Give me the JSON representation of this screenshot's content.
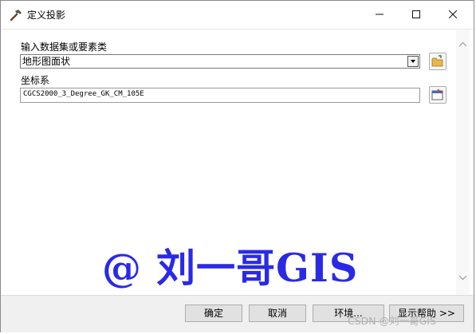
{
  "window": {
    "title": "定义投影",
    "minimize_icon": "minimize-icon",
    "maximize_icon": "maximize-icon",
    "close_icon": "close-icon"
  },
  "form": {
    "input_label": "输入数据集或要素类",
    "input_value": "地形图面状",
    "coord_label": "坐标系",
    "coord_value": "CGCS2000_3_Degree_GK_CM_105E"
  },
  "watermark": "@ 刘一哥GIS",
  "buttons": {
    "ok": "确定",
    "cancel": "取消",
    "environment": "环境...",
    "help": "显示帮助 >>"
  },
  "credit": "CSDN @刘一哥GIS",
  "colors": {
    "watermark": "#2a2ae6",
    "folder": "#e8b84a"
  }
}
